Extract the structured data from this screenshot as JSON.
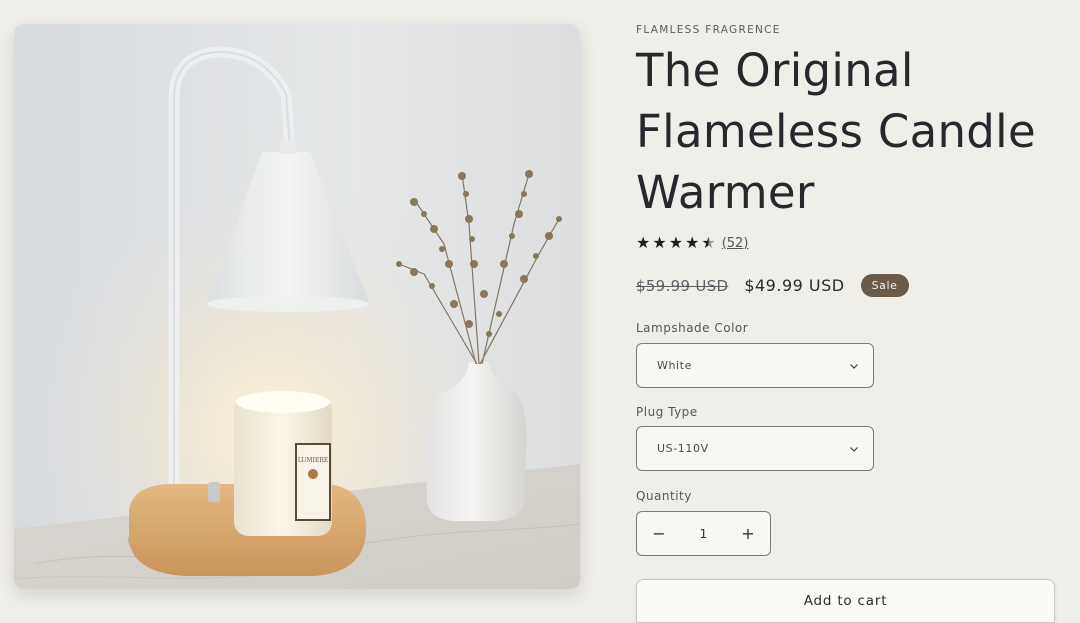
{
  "product": {
    "vendor": "FLAMLESS FRAGRENCE",
    "title": "The Original Flameless Candle Warmer",
    "rating": {
      "stars": 4.5,
      "max_stars": 5,
      "count_label": "(52)"
    },
    "price": {
      "compare_at": "$59.99 USD",
      "current": "$49.99 USD",
      "badge": "Sale"
    },
    "options": {
      "lampshade_color": {
        "label": "Lampshade Color",
        "value": "White"
      },
      "plug_type": {
        "label": "Plug Type",
        "value": "US-110V"
      }
    },
    "quantity": {
      "label": "Quantity",
      "value": "1",
      "decrease_symbol": "−",
      "increase_symbol": "+"
    },
    "add_to_cart_label": "Add to cart"
  },
  "image": {
    "subject": "white candle warmer lamp with candle jar and dried flowers in vase",
    "candle_label_brand": "LUMIERE"
  },
  "colors": {
    "background": "#f0eee9",
    "sale_badge": "#6a5a4a",
    "text": "#27272d"
  }
}
